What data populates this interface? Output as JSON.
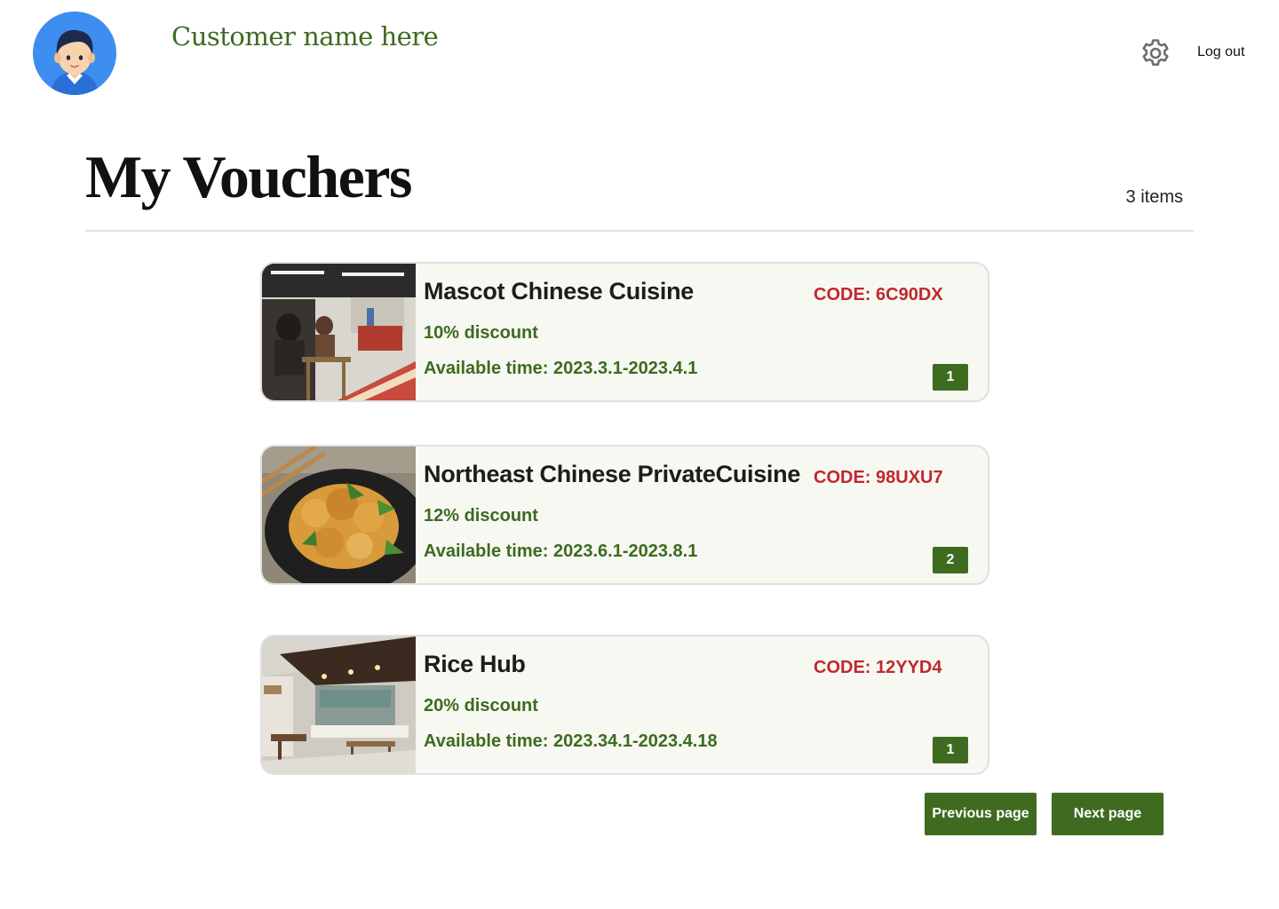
{
  "header": {
    "customer_name": "Customer name here",
    "logout_label": "Log out",
    "icons": {
      "avatar": "user-avatar",
      "settings": "gear-icon"
    }
  },
  "main": {
    "title": "My Vouchers",
    "item_count": "3 items",
    "vouchers": [
      {
        "name": "Mascot Chinese Cuisine",
        "code": "CODE: 6C90DX",
        "discount": "10% discount",
        "available": "Available time: 2023.3.1-2023.4.1",
        "quantity": "1"
      },
      {
        "name": "Northeast Chinese PrivateCuisine",
        "code": "CODE: 98UXU7",
        "discount": "12% discount",
        "available": "Available time: 2023.6.1-2023.8.1",
        "quantity": "2"
      },
      {
        "name": "Rice Hub",
        "code": "CODE: 12YYD4",
        "discount": "20% discount",
        "available": "Available time: 2023.34.1-2023.4.18",
        "quantity": "1"
      }
    ]
  },
  "pagination": {
    "previous_label": "Previous page",
    "next_label": "Next page"
  },
  "colors": {
    "brand_green": "#3f6b21",
    "text_green": "#3d6b1f",
    "code_red": "#c1272d",
    "card_bg": "#f7f8f2",
    "avatar_bg": "#3d8ef0"
  }
}
